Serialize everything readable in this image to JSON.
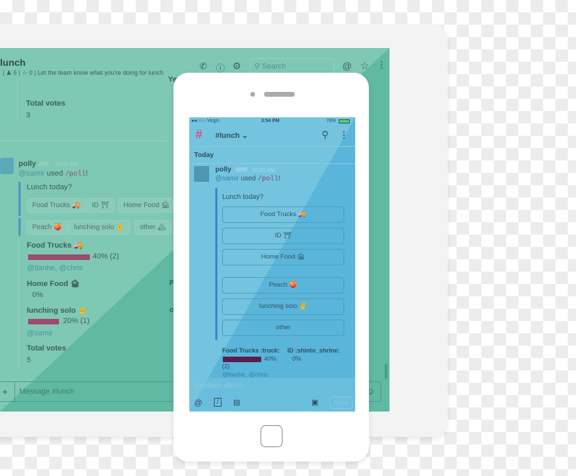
{
  "desktop": {
    "channel": "lunch",
    "members": "6",
    "pins": "0",
    "topic": "Let the team know what you're doing for lunch",
    "search_placeholder": "Search",
    "prev_total_votes_label": "Total votes",
    "prev_total_votes": "3",
    "message": {
      "sender": "polly",
      "badge": "APP",
      "time": "10:00 AM",
      "mention": "@samir",
      "used": "used",
      "command": "/poll",
      "bang": "!"
    },
    "question": "Lunch today?",
    "options": [
      "Food Trucks 🚚",
      "ID ⛩",
      "Home Food 🏚",
      "Peach 🍑",
      "lunching solo ✌",
      "other 🏔"
    ],
    "results": [
      {
        "label": "Food Trucks 🚚",
        "percent": 40,
        "text": "40% (2)",
        "voters": "@tianhe, @chris"
      },
      {
        "label": "Home Food 🏚",
        "percent": 0,
        "text": "0%",
        "voters": ""
      },
      {
        "label": "lunching solo ✌",
        "percent": 20,
        "text": "20% (1)",
        "voters": "@samir"
      }
    ],
    "total_votes_label": "Total votes",
    "total_votes": "5",
    "composer_placeholder": "Message #lunch",
    "partial_right": [
      "Ye",
      "P",
      "o"
    ],
    "colors": {
      "screen": "#7fc8b4",
      "bar": "#9c4a6e"
    }
  },
  "phone": {
    "carrier": "●●○○○ Virgin",
    "time": "3:54 PM",
    "battery": "78%",
    "channel": "#lunch",
    "day": "Today",
    "message": {
      "sender": "polly",
      "badge": "APP",
      "time": "10:00 AM",
      "mention": "@samir",
      "used": "used",
      "command": "/poll",
      "bang": "!"
    },
    "question": "Lunch today?",
    "options": [
      "Food Trucks 🚚",
      "ID ⛩",
      "Home Food 🏚",
      "Peach 🍑",
      "lunching solo ✌",
      "other"
    ],
    "results": [
      {
        "label": "Food Trucks :truck:",
        "percent": 40,
        "text": "40%",
        "count": "(2)",
        "voters": "@tianhe, @chris"
      },
      {
        "label": "ID :shinto_shrine:",
        "percent": 0,
        "text": "0%"
      }
    ],
    "composer_placeholder": "Message #lunch",
    "send_label": "Send",
    "colors": {
      "screen": "#74c4df",
      "bar": "#5a1d4a"
    }
  }
}
